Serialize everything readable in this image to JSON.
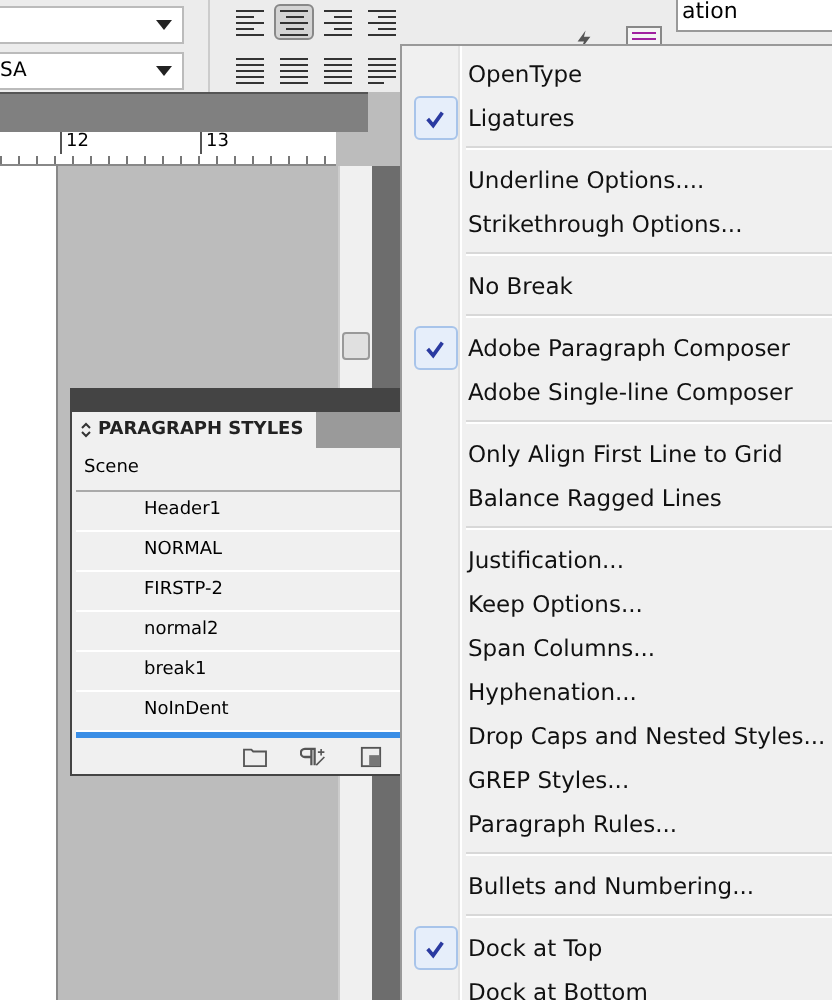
{
  "toolbar": {
    "fields": [
      {
        "value": "SA"
      }
    ],
    "align_buttons": [
      {
        "selected": false
      },
      {
        "selected": true
      },
      {
        "selected": false
      },
      {
        "selected": false
      },
      {
        "selected": false
      },
      {
        "selected": false
      },
      {
        "selected": false
      },
      {
        "selected": false
      }
    ],
    "corner_tab": "ation"
  },
  "ruler": {
    "labels": [
      "12",
      "13"
    ]
  },
  "panel": {
    "title": "PARAGRAPH STYLES",
    "group": "Scene",
    "styles": [
      "Header1",
      "NORMAL",
      "FIRSTP-2",
      "normal2",
      "break1",
      "NoInDent"
    ]
  },
  "menu": {
    "groups": [
      [
        {
          "label": "OpenType",
          "checked": false
        },
        {
          "label": "Ligatures",
          "checked": true
        }
      ],
      [
        {
          "label": "Underline Options....",
          "checked": false
        },
        {
          "label": "Strikethrough Options...",
          "checked": false
        }
      ],
      [
        {
          "label": "No Break",
          "checked": false
        }
      ],
      [
        {
          "label": "Adobe Paragraph Composer",
          "checked": true
        },
        {
          "label": "Adobe Single-line Composer",
          "checked": false
        }
      ],
      [
        {
          "label": "Only Align First Line to Grid",
          "checked": false
        },
        {
          "label": "Balance Ragged Lines",
          "checked": false
        }
      ],
      [
        {
          "label": "Justification...",
          "checked": false
        },
        {
          "label": "Keep Options...",
          "checked": false
        },
        {
          "label": "Span Columns...",
          "checked": false
        },
        {
          "label": "Hyphenation...",
          "checked": false
        },
        {
          "label": "Drop Caps and Nested Styles...",
          "checked": false
        },
        {
          "label": "GREP Styles...",
          "checked": false
        },
        {
          "label": "Paragraph Rules...",
          "checked": false
        }
      ],
      [
        {
          "label": "Bullets and Numbering...",
          "checked": false
        }
      ],
      [
        {
          "label": "Dock at Top",
          "checked": true
        },
        {
          "label": "Dock at Bottom",
          "checked": false
        }
      ]
    ]
  }
}
